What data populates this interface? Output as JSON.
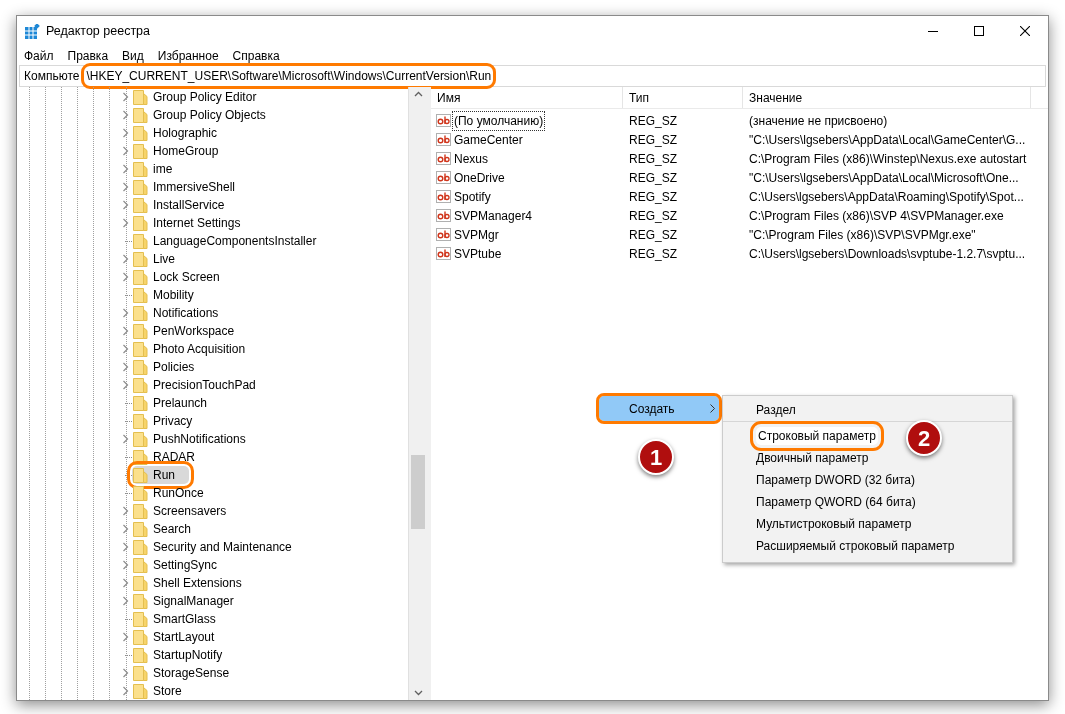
{
  "window": {
    "title": "Редактор реестра"
  },
  "menu": [
    "Файл",
    "Правка",
    "Вид",
    "Избранное",
    "Справка"
  ],
  "address": {
    "prefix": "Компьюте",
    "path": "\\HKEY_CURRENT_USER\\Software\\Microsoft\\Windows\\CurrentVersion\\Run",
    "annotated": true
  },
  "tree": [
    {
      "label": "Group Policy Editor",
      "expandable": true,
      "selected": false,
      "annotated": false
    },
    {
      "label": "Group Policy Objects",
      "expandable": true,
      "selected": false,
      "annotated": false
    },
    {
      "label": "Holographic",
      "expandable": true,
      "selected": false,
      "annotated": false
    },
    {
      "label": "HomeGroup",
      "expandable": true,
      "selected": false,
      "annotated": false
    },
    {
      "label": "ime",
      "expandable": true,
      "selected": false,
      "annotated": false
    },
    {
      "label": "ImmersiveShell",
      "expandable": true,
      "selected": false,
      "annotated": false
    },
    {
      "label": "InstallService",
      "expandable": true,
      "selected": false,
      "annotated": false
    },
    {
      "label": "Internet Settings",
      "expandable": true,
      "selected": false,
      "annotated": false
    },
    {
      "label": "LanguageComponentsInstaller",
      "expandable": false,
      "selected": false,
      "annotated": false
    },
    {
      "label": "Live",
      "expandable": true,
      "selected": false,
      "annotated": false
    },
    {
      "label": "Lock Screen",
      "expandable": true,
      "selected": false,
      "annotated": false
    },
    {
      "label": "Mobility",
      "expandable": false,
      "selected": false,
      "annotated": false
    },
    {
      "label": "Notifications",
      "expandable": true,
      "selected": false,
      "annotated": false
    },
    {
      "label": "PenWorkspace",
      "expandable": true,
      "selected": false,
      "annotated": false
    },
    {
      "label": "Photo Acquisition",
      "expandable": true,
      "selected": false,
      "annotated": false
    },
    {
      "label": "Policies",
      "expandable": true,
      "selected": false,
      "annotated": false
    },
    {
      "label": "PrecisionTouchPad",
      "expandable": true,
      "selected": false,
      "annotated": false
    },
    {
      "label": "Prelaunch",
      "expandable": false,
      "selected": false,
      "annotated": false
    },
    {
      "label": "Privacy",
      "expandable": false,
      "selected": false,
      "annotated": false
    },
    {
      "label": "PushNotifications",
      "expandable": true,
      "selected": false,
      "annotated": false
    },
    {
      "label": "RADAR",
      "expandable": false,
      "selected": false,
      "annotated": false
    },
    {
      "label": "Run",
      "expandable": false,
      "selected": true,
      "annotated": true
    },
    {
      "label": "RunOnce",
      "expandable": false,
      "selected": false,
      "annotated": false
    },
    {
      "label": "Screensavers",
      "expandable": true,
      "selected": false,
      "annotated": false
    },
    {
      "label": "Search",
      "expandable": true,
      "selected": false,
      "annotated": false
    },
    {
      "label": "Security and Maintenance",
      "expandable": true,
      "selected": false,
      "annotated": false
    },
    {
      "label": "SettingSync",
      "expandable": true,
      "selected": false,
      "annotated": false
    },
    {
      "label": "Shell Extensions",
      "expandable": true,
      "selected": false,
      "annotated": false
    },
    {
      "label": "SignalManager",
      "expandable": true,
      "selected": false,
      "annotated": false
    },
    {
      "label": "SmartGlass",
      "expandable": false,
      "selected": false,
      "annotated": false
    },
    {
      "label": "StartLayout",
      "expandable": true,
      "selected": false,
      "annotated": false
    },
    {
      "label": "StartupNotify",
      "expandable": false,
      "selected": false,
      "annotated": false
    },
    {
      "label": "StorageSense",
      "expandable": true,
      "selected": false,
      "annotated": false
    },
    {
      "label": "Store",
      "expandable": true,
      "selected": false,
      "annotated": false
    }
  ],
  "table": {
    "columns": [
      "Имя",
      "Тип",
      "Значение"
    ],
    "rows": [
      {
        "name": "(По умолчанию)",
        "type": "REG_SZ",
        "value": "(значение не присвоено)",
        "focused": true
      },
      {
        "name": "GameCenter",
        "type": "REG_SZ",
        "value": "\"C:\\Users\\lgsebers\\AppData\\Local\\GameCenter\\G...",
        "focused": false
      },
      {
        "name": "Nexus",
        "type": "REG_SZ",
        "value": "C:\\Program Files (x86)\\Winstep\\Nexus.exe autostart",
        "focused": false
      },
      {
        "name": "OneDrive",
        "type": "REG_SZ",
        "value": "\"C:\\Users\\lgsebers\\AppData\\Local\\Microsoft\\One...",
        "focused": false
      },
      {
        "name": "Spotify",
        "type": "REG_SZ",
        "value": "C:\\Users\\lgsebers\\AppData\\Roaming\\Spotify\\Spot...",
        "focused": false
      },
      {
        "name": "SVPManager4",
        "type": "REG_SZ",
        "value": "C:\\Program Files (x86)\\SVP 4\\SVPManager.exe",
        "focused": false
      },
      {
        "name": "SVPMgr",
        "type": "REG_SZ",
        "value": "\"C:\\Program Files (x86)\\SVP\\SVPMgr.exe\"",
        "focused": false
      },
      {
        "name": "SVPtube",
        "type": "REG_SZ",
        "value": "C:\\Users\\lgsebers\\Downloads\\svptube-1.2.7\\svptu...",
        "focused": false
      }
    ]
  },
  "context_menu": {
    "label": "Создать",
    "selected": true,
    "annotated": true,
    "marker": "1"
  },
  "submenu": [
    {
      "label": "Раздел",
      "separator_after": true,
      "annotated": false
    },
    {
      "label": "Строковый параметр",
      "separator_after": false,
      "annotated": true,
      "marker": "2"
    },
    {
      "label": "Двоичный параметр",
      "separator_after": false,
      "annotated": false
    },
    {
      "label": "Параметр DWORD (32 бита)",
      "separator_after": false,
      "annotated": false
    },
    {
      "label": "Параметр QWORD (64 бита)",
      "separator_after": false,
      "annotated": false
    },
    {
      "label": "Мультистроковый параметр",
      "separator_after": false,
      "annotated": false
    },
    {
      "label": "Расширяемый строковый параметр",
      "separator_after": false,
      "annotated": false
    }
  ]
}
